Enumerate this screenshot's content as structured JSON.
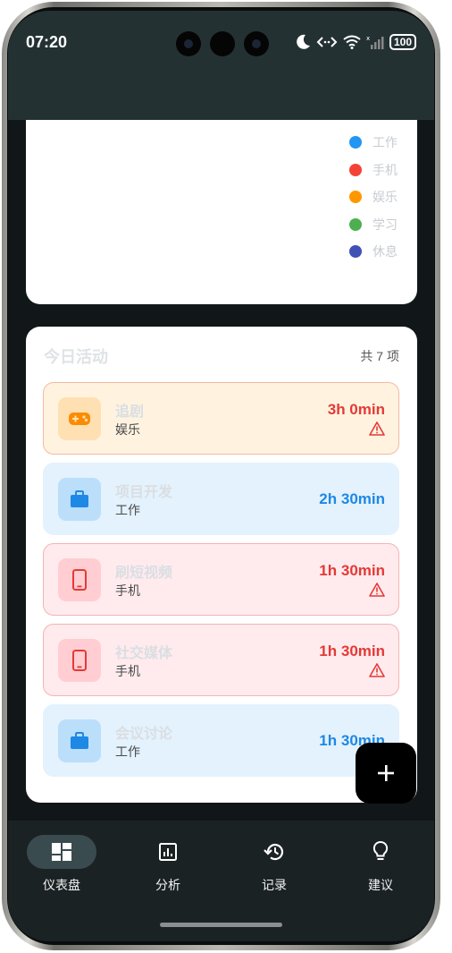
{
  "status_bar": {
    "time": "07:20",
    "battery": "100"
  },
  "legend": [
    {
      "label": "工作",
      "color": "#2196f3"
    },
    {
      "label": "手机",
      "color": "#f44336"
    },
    {
      "label": "娱乐",
      "color": "#ff9800"
    },
    {
      "label": "学习",
      "color": "#4caf50"
    },
    {
      "label": "休息",
      "color": "#3f51b5"
    }
  ],
  "activity": {
    "title": "今日活动",
    "count": "共 7 项",
    "items": [
      {
        "name": "追剧",
        "category": "娱乐",
        "duration": "3h 0min",
        "icon": "gamepad-icon",
        "warning": true,
        "bg": "#fff3e0",
        "border": "#f3b9a3",
        "icon_bg": "#ffe0b2",
        "accent": "#e53935",
        "icon_color": "#fb8c00"
      },
      {
        "name": "项目开发",
        "category": "工作",
        "duration": "2h 30min",
        "icon": "briefcase-icon",
        "warning": false,
        "bg": "#e3f2fd",
        "border": "#e3f2fd",
        "icon_bg": "#bbdefb",
        "accent": "#1e88e5",
        "icon_color": "#1e88e5"
      },
      {
        "name": "刷短视频",
        "category": "手机",
        "duration": "1h 30min",
        "icon": "phone-icon",
        "warning": true,
        "bg": "#ffebee",
        "border": "#f3b3b3",
        "icon_bg": "#ffcdd2",
        "accent": "#e53935",
        "icon_color": "#e53935"
      },
      {
        "name": "社交媒体",
        "category": "手机",
        "duration": "1h 30min",
        "icon": "phone-icon",
        "warning": true,
        "bg": "#ffebee",
        "border": "#f3b3b3",
        "icon_bg": "#ffcdd2",
        "accent": "#e53935",
        "icon_color": "#e53935"
      },
      {
        "name": "会议讨论",
        "category": "工作",
        "duration": "1h 30min",
        "icon": "briefcase-icon",
        "warning": false,
        "bg": "#e3f2fd",
        "border": "#e3f2fd",
        "icon_bg": "#bbdefb",
        "accent": "#1e88e5",
        "icon_color": "#1e88e5"
      }
    ]
  },
  "fab": {
    "icon": "plus-icon"
  },
  "nav": [
    {
      "label": "仪表盘",
      "icon": "dashboard-icon",
      "active": true
    },
    {
      "label": "分析",
      "icon": "chart-icon",
      "active": false
    },
    {
      "label": "记录",
      "icon": "history-icon",
      "active": false
    },
    {
      "label": "建议",
      "icon": "lightbulb-icon",
      "active": false
    }
  ]
}
